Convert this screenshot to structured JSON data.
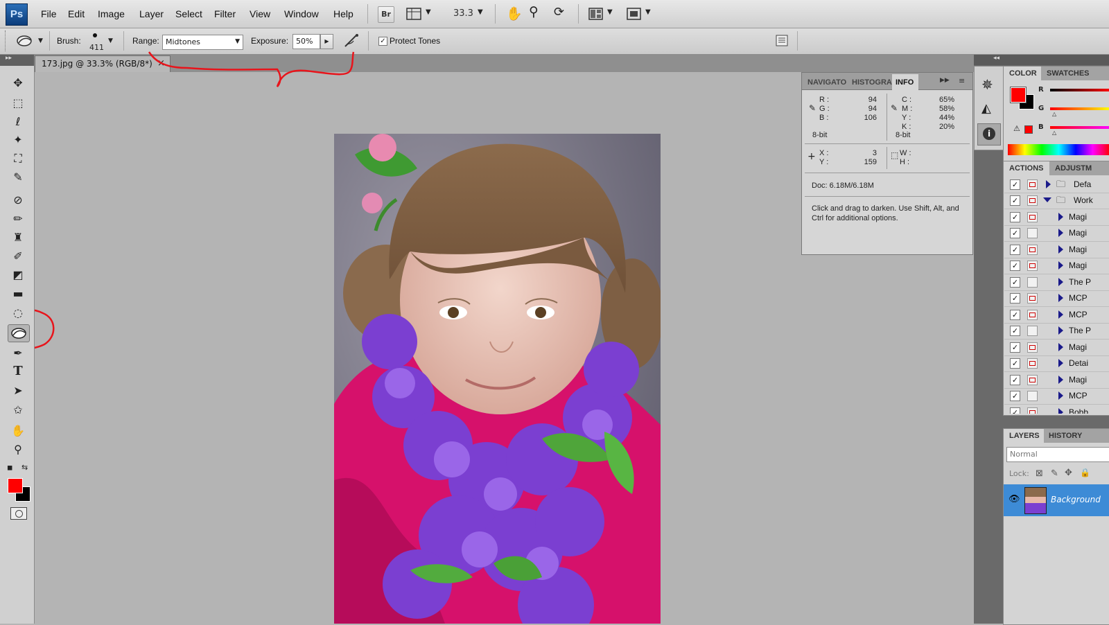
{
  "app": {
    "logo": "Ps"
  },
  "menu": [
    "File",
    "Edit",
    "Image",
    "Layer",
    "Select",
    "Filter",
    "View",
    "Window",
    "Help"
  ],
  "menubar_buttons": {
    "bridge": "Br",
    "zoom": "33.3"
  },
  "options": {
    "brush_label": "Brush:",
    "brush_size": "411",
    "range_label": "Range:",
    "range_value": "Midtones",
    "exposure_label": "Exposure:",
    "exposure_value": "50%",
    "protect_tones_label": "Protect Tones",
    "protect_tones_checked": true
  },
  "document": {
    "tab_title": "173.jpg @ 33.3% (RGB/8*)",
    "close": "×"
  },
  "info_panel": {
    "tabs": [
      "NAVIGATO",
      "HISTOGRA",
      "INFO"
    ],
    "rgb": [
      {
        "k": "R :",
        "v": "94"
      },
      {
        "k": "G :",
        "v": "94"
      },
      {
        "k": "B :",
        "v": "106"
      }
    ],
    "rgb_bit": "8-bit",
    "cmyk": [
      {
        "k": "C :",
        "v": "65%"
      },
      {
        "k": "M :",
        "v": "58%"
      },
      {
        "k": "Y :",
        "v": "44%"
      },
      {
        "k": "K :",
        "v": "20%"
      }
    ],
    "cmyk_bit": "8-bit",
    "xy": [
      {
        "k": "X :",
        "v": "3"
      },
      {
        "k": "Y :",
        "v": "159"
      }
    ],
    "wh": [
      {
        "k": "W :",
        "v": ""
      },
      {
        "k": "H :",
        "v": ""
      }
    ],
    "doc": "Doc: 6.18M/6.18M",
    "hint": "Click and drag to darken.  Use Shift, Alt, and Ctrl for additional options."
  },
  "color_panel": {
    "tabs": [
      "COLOR",
      "SWATCHES"
    ],
    "channels": [
      "R",
      "G",
      "B"
    ],
    "foreground": "#ff0000",
    "background": "#000000"
  },
  "actions_panel": {
    "tabs": [
      "ACTIONS",
      "ADJUSTM"
    ],
    "rows": [
      {
        "label": "Defa",
        "folder": true,
        "expanded": false,
        "dialog": true
      },
      {
        "label": "Work",
        "folder": true,
        "expanded": true,
        "dialog": true
      },
      {
        "label": "Magi",
        "dialog": true
      },
      {
        "label": "Magi",
        "dialog": false
      },
      {
        "label": "Magi",
        "dialog": true
      },
      {
        "label": "Magi",
        "dialog": true
      },
      {
        "label": "The P",
        "dialog": false
      },
      {
        "label": "MCP",
        "dialog": true
      },
      {
        "label": "MCP",
        "dialog": true
      },
      {
        "label": "The P",
        "dialog": false
      },
      {
        "label": "Magi",
        "dialog": true
      },
      {
        "label": "Detai",
        "dialog": true
      },
      {
        "label": "Magi",
        "dialog": true
      },
      {
        "label": "MCP",
        "dialog": false
      },
      {
        "label": "Bobb",
        "dialog": true
      }
    ]
  },
  "layers_panel": {
    "tabs": [
      "LAYERS",
      "HISTORY"
    ],
    "blend_mode": "Normal",
    "lock_label": "Lock:",
    "layer_name": "Background"
  },
  "colors": {
    "annotation": "#e8141b",
    "selected_layer": "#3d8bd6"
  }
}
